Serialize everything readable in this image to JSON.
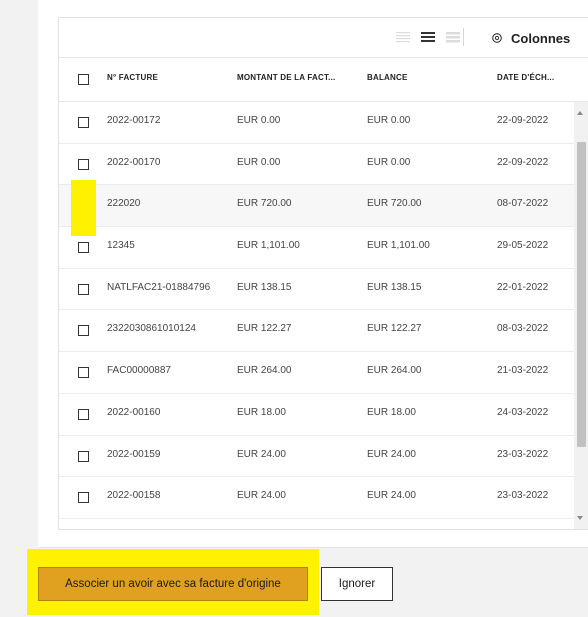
{
  "toolbar": {
    "density_options": [
      "density-compact-icon",
      "density-standard-icon",
      "density-comfortable-icon"
    ],
    "selected_density": "standard",
    "columns_icon": "settings-cog-icon",
    "columns_label": "Colonnes"
  },
  "table": {
    "headers": [
      "N° FACTURE",
      "MONTANT DE LA FACT...",
      "BALANCE",
      "DATE D'ÉCH..."
    ],
    "rows": [
      {
        "checked": false,
        "number": "2022-00172",
        "amount": "EUR 0.00",
        "balance": "EUR 0.00",
        "due_date": "22-09-2022"
      },
      {
        "checked": false,
        "number": "2022-00170",
        "amount": "EUR 0.00",
        "balance": "EUR 0.00",
        "due_date": "22-09-2022"
      },
      {
        "checked": true,
        "number": "222020",
        "amount": "EUR 720.00",
        "balance": "EUR 720.00",
        "due_date": "08-07-2022"
      },
      {
        "checked": false,
        "number": "12345",
        "amount": "EUR 1,101.00",
        "balance": "EUR 1,101.00",
        "due_date": "29-05-2022"
      },
      {
        "checked": false,
        "number": "NATLFAC21-01884796",
        "amount": "EUR 138.15",
        "balance": "EUR 138.15",
        "due_date": "22-01-2022"
      },
      {
        "checked": false,
        "number": "2322030861010124",
        "amount": "EUR 122.27",
        "balance": "EUR 122.27",
        "due_date": "08-03-2022"
      },
      {
        "checked": false,
        "number": "FAC00000887",
        "amount": "EUR 264.00",
        "balance": "EUR 264.00",
        "due_date": "21-03-2022"
      },
      {
        "checked": false,
        "number": "2022-00160",
        "amount": "EUR 18.00",
        "balance": "EUR 18.00",
        "due_date": "24-03-2022"
      },
      {
        "checked": false,
        "number": "2022-00159",
        "amount": "EUR 24.00",
        "balance": "EUR 24.00",
        "due_date": "23-03-2022"
      },
      {
        "checked": false,
        "number": "2022-00158",
        "amount": "EUR 24.00",
        "balance": "EUR 24.00",
        "due_date": "23-03-2022"
      }
    ]
  },
  "actions": {
    "primary_label": "Associer un avoir avec sa facture d'origine",
    "secondary_label": "Ignorer"
  },
  "colors": {
    "highlight": "#fff200",
    "primary_button": "#e0a020",
    "selected_row": "#f7f7f7"
  }
}
